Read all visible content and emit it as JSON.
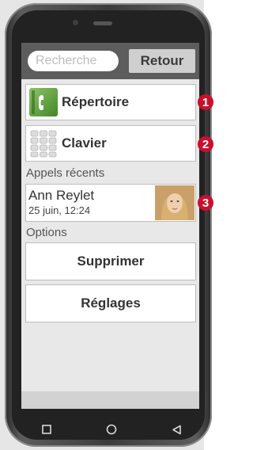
{
  "search": {
    "placeholder": "Recherche"
  },
  "header": {
    "back_label": "Retour"
  },
  "menu": {
    "directory_label": "Répertoire",
    "keypad_label": "Clavier"
  },
  "recent_calls": {
    "header": "Appels récents",
    "items": [
      {
        "name": "Ann Reylet",
        "time": "25 juin, 12:24"
      }
    ]
  },
  "options": {
    "header": "Options",
    "delete_label": "Supprimer",
    "settings_label": "Réglages"
  },
  "callouts": [
    "1",
    "2",
    "3"
  ],
  "colors": {
    "header_bg": "#5d5d5d",
    "screen_bg": "#e8e8e8",
    "badge": "#c8102e",
    "phone_icon_green": "#5ca33a"
  },
  "icons": {
    "nav_recent": "square-icon",
    "nav_home": "circle-icon",
    "nav_back": "triangle-back-icon"
  }
}
